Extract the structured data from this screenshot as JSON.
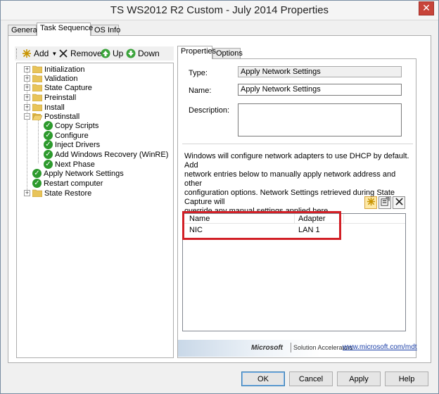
{
  "window": {
    "title": "TS WS2012 R2 Custom - July 2014 Properties",
    "close_symbol": "✕"
  },
  "tabs": [
    "General",
    "Task Sequence",
    "OS Info"
  ],
  "toolbar": {
    "add": "Add",
    "remove": "Remove",
    "up": "Up",
    "down": "Down"
  },
  "tree": {
    "initialization": "Initialization",
    "validation": "Validation",
    "state_capture": "State Capture",
    "preinstall": "Preinstall",
    "install": "Install",
    "postinstall": "Postinstall",
    "copy_scripts": "Copy Scripts",
    "configure": "Configure",
    "inject_drivers": "Inject Drivers",
    "add_winre": "Add Windows Recovery (WinRE)",
    "next_phase": "Next Phase",
    "apply_network": "Apply Network Settings",
    "restart": "Restart computer",
    "state_restore": "State Restore"
  },
  "right_tabs": [
    "Properties",
    "Options"
  ],
  "properties": {
    "type_label": "Type:",
    "type_value": "Apply Network Settings",
    "name_label": "Name:",
    "name_value": "Apply Network Settings",
    "description_label": "Description:",
    "description_value": "",
    "info_lines": [
      "Windows will configure network adapters to use DHCP by default. Add",
      "network entries below to manually apply network address and other",
      "configuration options. Network Settings retrieved during State Capture will",
      "override any manual settings applied here."
    ]
  },
  "list": {
    "columns": [
      "Name",
      "Adapter"
    ],
    "rows": [
      {
        "name": "NIC",
        "adapter": "LAN 1"
      }
    ]
  },
  "banner": {
    "brand": "Microsoft",
    "product": "Solution Accelerators",
    "link": "www.microsoft.com/mdt"
  },
  "buttons": {
    "ok": "OK",
    "cancel": "Cancel",
    "apply": "Apply",
    "help": "Help"
  },
  "colors": {
    "highlight": "#d21f26",
    "check": "#2d9a2d",
    "folder": "#e8c45a"
  }
}
